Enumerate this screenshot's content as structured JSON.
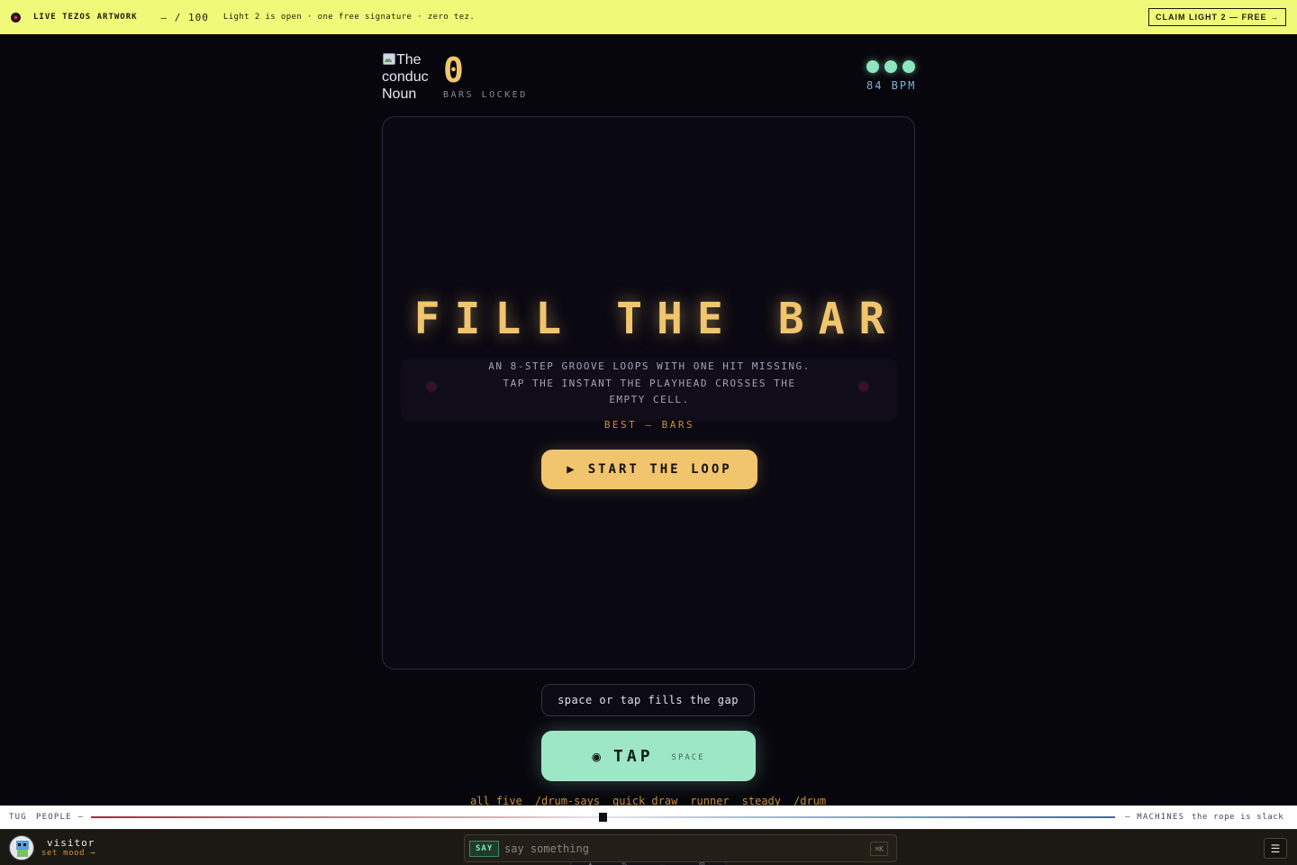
{
  "banner": {
    "title": "LIVE TEZOS ARTWORK",
    "count": "— / 100",
    "message": "Light 2 is open · one free signature · zero tez.",
    "claim_label": "CLAIM LIGHT 2 — FREE →"
  },
  "header": {
    "noun_alt": "The conductor Noun",
    "noun_visible_text": "The conduc Noun",
    "score": "0",
    "score_label": "BARS LOCKED",
    "bpm": "84 BPM",
    "lives": 3
  },
  "stage": {
    "headline": "FILL THE BAR",
    "description": "AN 8-STEP GROOVE LOOPS WITH ONE HIT MISSING. TAP THE INSTANT THE PLAYHEAD CROSSES THE EMPTY CELL.",
    "best": "BEST — BARS",
    "start_label": "START THE LOOP",
    "start_icon": "▶"
  },
  "hint": "space or tap fills the gap",
  "tap": {
    "icon": "◉",
    "label": "TAP",
    "key": "SPACE"
  },
  "chips": [
    "all five",
    "/drum-says",
    "quick draw",
    "runner",
    "steady",
    "/drum"
  ],
  "tug": {
    "label": "TUG",
    "people": "PEOPLE —",
    "machines": "— MACHINES",
    "status": "the rope is slack",
    "balance": 0.5
  },
  "bottom": {
    "user_name": "visitor",
    "mood_link": "set mood →",
    "say_tag": "SAY",
    "say_placeholder": "say something",
    "say_shortcut": "⌘K",
    "menu_icon": "☰"
  },
  "colors": {
    "banner_bg": "#f0fa78",
    "accent_gold": "#f0c56e",
    "accent_mint": "#9ee7c6",
    "bpm_blue": "#7fb2d6",
    "people_red": "#a5283c",
    "machines_blue": "#3a6aa0"
  }
}
